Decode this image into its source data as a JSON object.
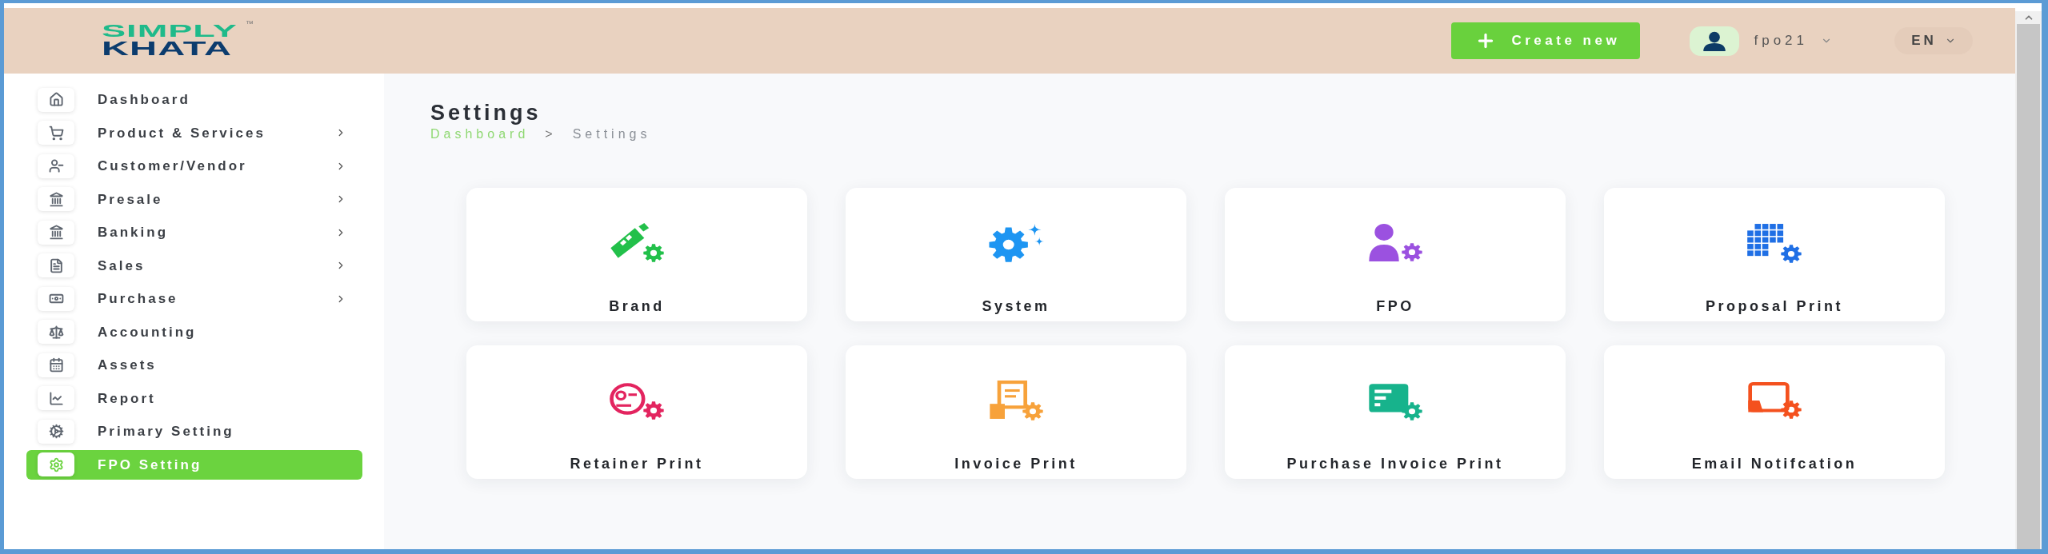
{
  "logo": {
    "top": "SIMPLY",
    "bottom": "KHATA",
    "mark": "™"
  },
  "header": {
    "create_button": {
      "label": "Create new"
    },
    "user_menu": {
      "name": "fpo21"
    },
    "language": {
      "value": "EN"
    }
  },
  "sidebar": {
    "items": [
      {
        "label": "Dashboard",
        "selected": false,
        "has_submenu": false
      },
      {
        "label": "Product & Services",
        "selected": false,
        "has_submenu": true
      },
      {
        "label": "Customer/Vendor",
        "selected": false,
        "has_submenu": true
      },
      {
        "label": "Presale",
        "selected": false,
        "has_submenu": true
      },
      {
        "label": "Banking",
        "selected": false,
        "has_submenu": true
      },
      {
        "label": "Sales",
        "selected": false,
        "has_submenu": true
      },
      {
        "label": "Purchase",
        "selected": false,
        "has_submenu": true
      },
      {
        "label": "Accounting",
        "selected": false,
        "has_submenu": false
      },
      {
        "label": "Assets",
        "selected": false,
        "has_submenu": false
      },
      {
        "label": "Report",
        "selected": false,
        "has_submenu": false
      },
      {
        "label": "Primary Setting",
        "selected": false,
        "has_submenu": false
      },
      {
        "label": "FPO Setting",
        "selected": true,
        "has_submenu": false
      }
    ]
  },
  "page": {
    "title": "Settings",
    "breadcrumb": {
      "items": [
        {
          "label": "Dashboard",
          "current": false
        },
        {
          "label": "Settings",
          "current": true
        }
      ],
      "separator": ">"
    }
  },
  "cards": [
    {
      "label": "Brand"
    },
    {
      "label": "System"
    },
    {
      "label": "FPO"
    },
    {
      "label": "Proposal Print"
    },
    {
      "label": "Retainer Print"
    },
    {
      "label": "Invoice Print"
    },
    {
      "label": "Purchase Invoice Print"
    },
    {
      "label": "Email Notifcation"
    }
  ]
}
